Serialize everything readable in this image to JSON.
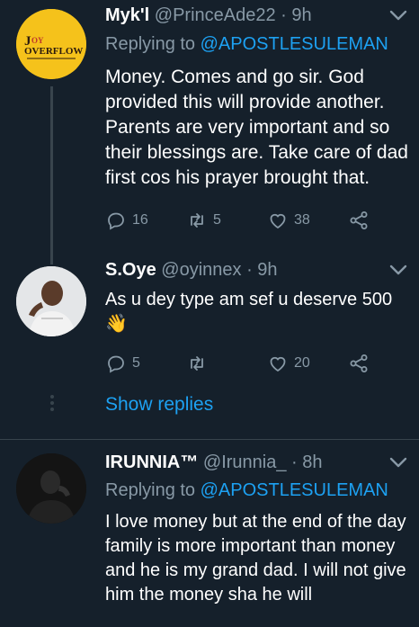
{
  "tweets": [
    {
      "name": "Myk'l",
      "handle": "@PrinceAde22",
      "time": "· 9h",
      "replying_prefix": "Replying to",
      "replying_to": "@APOSTLESULEMAN",
      "text": "Money.  Comes and go sir. God provided this will provide another. Parents are very important and so their blessings are. Take care of dad first cos his prayer brought that.",
      "avatar_logo": "JOY OVERFLOW",
      "avatar_color": "#f5c21b",
      "replies": "16",
      "retweets": "5",
      "likes": "38"
    },
    {
      "name": "S.Oye",
      "handle": "@oyinnex",
      "time": "· 9h",
      "text": "As u dey type am sef u deserve 500",
      "emoji": "👋",
      "replies": "5",
      "retweets": "",
      "likes": "20"
    },
    {
      "name": "IRUNNIA™",
      "handle": "@Irunnia_",
      "time": "· 8h",
      "replying_prefix": "Replying to",
      "replying_to": "@APOSTLESULEMAN",
      "text": "I love money but at the end of the day family is more important than money and he is my grand dad. I will not give him the money sha he will"
    }
  ],
  "show_replies": "Show replies",
  "colors": {
    "background": "#15202b",
    "accent": "#1da1f2",
    "secondary": "#8899a6",
    "divider": "#38444d"
  },
  "icons": [
    "reply-icon",
    "retweet-icon",
    "like-icon",
    "share-icon",
    "chevron-down-icon"
  ]
}
